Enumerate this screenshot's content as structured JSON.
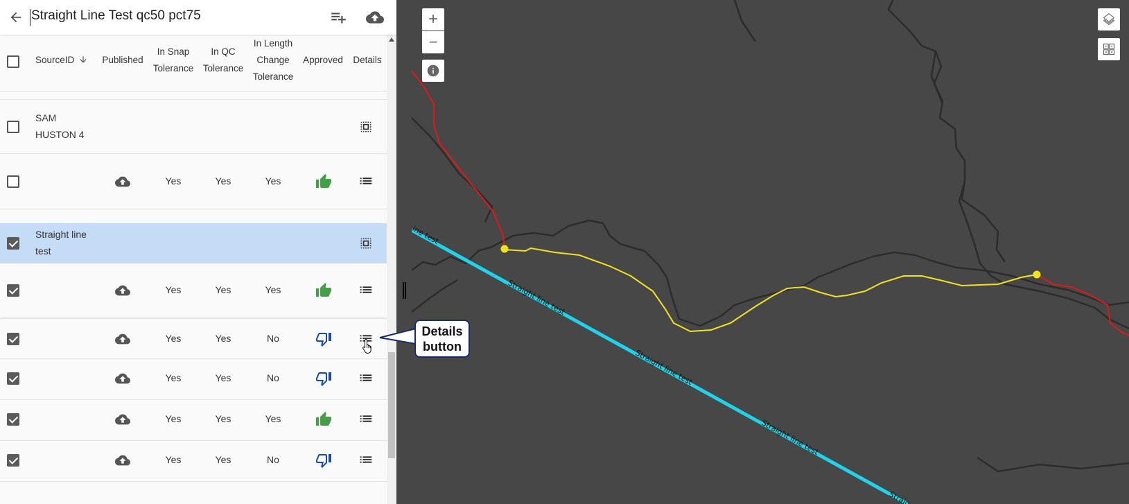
{
  "header": {
    "title": "Straight Line Test qc50 pct75",
    "back_icon": "arrow-left-icon",
    "add_icon": "playlist-add-icon",
    "upload_icon": "cloud-upload-icon"
  },
  "table": {
    "columns": [
      "SourceID",
      "Published",
      "In Snap",
      "Tolerance",
      "In QC",
      "Tolerance",
      "In Length",
      "Change",
      "Tolerance",
      "Approved",
      "Details"
    ],
    "col_labels": {
      "source_id": "SourceID",
      "published": "Published",
      "snap_1": "In Snap",
      "snap_2": "Tolerance",
      "qc_1": "In QC",
      "qc_2": "Tolerance",
      "len_1": "In Length",
      "len_2": "Change",
      "len_3": "Tolerance",
      "approved": "Approved",
      "details": "Details"
    },
    "groups": [
      {
        "line1": "SAM",
        "line2": "HUSTON 4"
      },
      {
        "line1": "Straight line",
        "line2": "test"
      }
    ],
    "rows": [
      {
        "snap": "Yes",
        "qc": "Yes",
        "length": "Yes",
        "approved": "thumb-up"
      },
      {
        "snap": "Yes",
        "qc": "Yes",
        "length": "Yes",
        "approved": "thumb-up"
      },
      {
        "snap": "Yes",
        "qc": "Yes",
        "length": "No",
        "approved": "thumb-down"
      },
      {
        "snap": "Yes",
        "qc": "Yes",
        "length": "No",
        "approved": "thumb-down"
      },
      {
        "snap": "Yes",
        "qc": "Yes",
        "length": "Yes",
        "approved": "thumb-up"
      },
      {
        "snap": "Yes",
        "qc": "Yes",
        "length": "No",
        "approved": "thumb-down"
      }
    ]
  },
  "map": {
    "zoom_in": "+",
    "zoom_out": "−",
    "info": "i",
    "line_label": "Straight line test",
    "line_label_partial": "ine test",
    "line_label_clip": "Straig",
    "colors": {
      "background": "#474747",
      "cyan_line": "#1ed3ea",
      "yellow_line": "#f2e31c",
      "red_line": "#e01818",
      "terrain": "#2c2c2c"
    }
  },
  "callout": {
    "line1": "Details",
    "line2": "button"
  },
  "colors": {
    "approve": "#43a047",
    "reject": "#1b4aa5",
    "selected_row": "#c5dcf7"
  }
}
